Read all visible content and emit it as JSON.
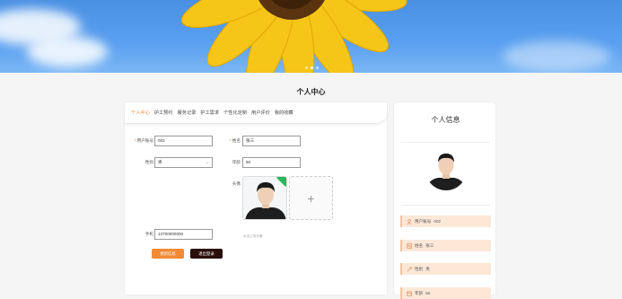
{
  "banner": {
    "carousel_dots": 3,
    "active_dot": 1
  },
  "page": {
    "title": "个人中心"
  },
  "tabs": [
    {
      "label": "个人中心",
      "active": true
    },
    {
      "label": "护工预约",
      "active": false
    },
    {
      "label": "服务记录",
      "active": false
    },
    {
      "label": "护工需求",
      "active": false
    },
    {
      "label": "个性化定制",
      "active": false
    },
    {
      "label": "用户评价",
      "active": false
    },
    {
      "label": "我的收藏",
      "active": false
    }
  ],
  "form": {
    "account_label": "用户账号",
    "account_value": "002",
    "name_label": "姓名",
    "name_value": "张三",
    "gender_label": "性别",
    "gender_value": "男",
    "age_label": "年龄",
    "age_value": "50",
    "avatar_label": "头像",
    "avatar_hint": "点击上传头像",
    "phone_label": "手机",
    "phone_value": "13700000000",
    "update_button": "更新信息",
    "logout_button": "退出登录",
    "upload_plus": "+"
  },
  "sidebar": {
    "title": "个人信息",
    "rows": [
      {
        "icon": "user-icon",
        "label": "用户账号",
        "value": "002"
      },
      {
        "icon": "id-card-icon",
        "label": "姓名",
        "value": "张三"
      },
      {
        "icon": "gender-icon",
        "label": "性别",
        "value": "男"
      },
      {
        "icon": "age-icon",
        "label": "年龄",
        "value": "50"
      }
    ]
  },
  "colors": {
    "accent": "#f08a3a",
    "update_button": "#f28a34",
    "logout_button": "#2a0e0a",
    "info_row_bg": "#fde8d8",
    "banner_sky": "#4a90e2",
    "sunflower": "#f5c518"
  }
}
